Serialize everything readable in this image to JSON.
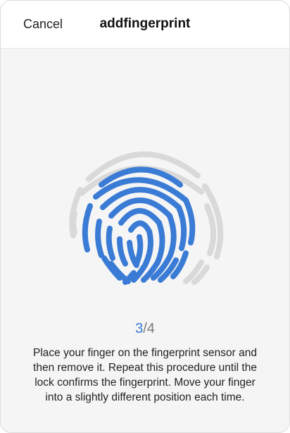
{
  "header": {
    "cancel_label": "Cancel",
    "title": "addfingerprint"
  },
  "progress": {
    "current": "3",
    "separator": "/",
    "total": "4"
  },
  "instructions": "Place your finger on the fingerprint sensor and then remove it. Repeat this procedure until the lock confirms the fingerprint. Move your finger into a slightly different position each time.",
  "colors": {
    "accent": "#3a7bd5",
    "ridge_inactive": "#d9d9d9",
    "background": "#f5f5f5"
  },
  "icons": {
    "fingerprint": "fingerprint-icon"
  }
}
